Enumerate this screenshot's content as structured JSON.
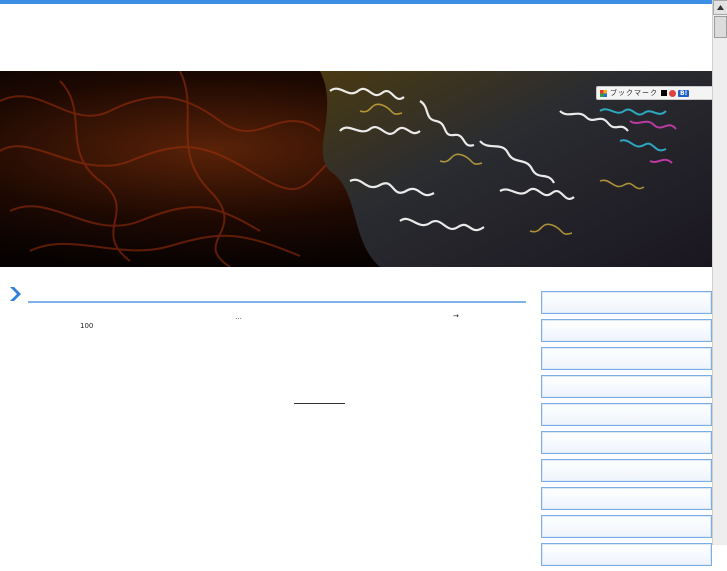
{
  "header": {
    "accent_color": "#3d8fe6"
  },
  "banner": {
    "bookmark_label": "ブックマーク",
    "badge_label": "B!"
  },
  "content": {
    "ellipsis": "…",
    "arrow": "→",
    "number": "100"
  },
  "sidebar": {
    "button_count": 10,
    "border_color": "#7aaee6"
  },
  "icons": [
    "chevron-right-icon",
    "bookmark-icon",
    "scroll-up-arrow-icon"
  ]
}
